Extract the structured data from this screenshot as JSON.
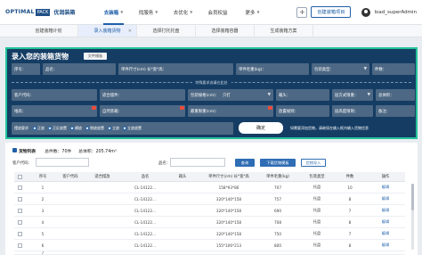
{
  "brand": {
    "logo_left": "OPTIMAL",
    "logo_box": "PACK",
    "logo_cn": "优润装箱"
  },
  "nav": [
    {
      "label": "去装箱",
      "active": true
    },
    {
      "label": "找服务"
    },
    {
      "label": "去优化"
    },
    {
      "label": "会员权益"
    },
    {
      "label": "更多"
    }
  ],
  "header": {
    "create_button": "创建装箱项目",
    "username": "load_superAdmin"
  },
  "tabs": [
    {
      "label": "创建装箱计划"
    },
    {
      "label": "录入装箱货物",
      "active": true
    },
    {
      "label": "选择打托托盘"
    },
    {
      "label": "选择装箱容器"
    },
    {
      "label": "生成装箱方案"
    }
  ],
  "entry": {
    "title": "录入您的装箱货物",
    "template_button": "文件模板",
    "fields_row1": [
      "序号：",
      "品名：",
      "单件尺寸(cm) 长*宽*高：",
      "单件毛重(kg)：",
      "包装类型：",
      "件数："
    ],
    "section_label": "特殊要求选填在此处",
    "fields_row2": [
      "客户代码：",
      "适合摆件：",
      "包装规格(cm)：",
      "箱头：",
      "层方式限重：",
      "总体积："
    ],
    "fields_row2_value": "只打",
    "fields_row3": [
      "堆高：",
      "自然装箱：",
      "最重限重(cm)：",
      "放置规则：",
      "层高度限制：",
      "备注："
    ],
    "options_label": "摆放要求",
    "options": [
      "正放",
      "正反放置",
      "横放",
      "侧放放置",
      "立放",
      "立放放置"
    ],
    "confirm_button": "确定",
    "hint": "如需要添加货物，请继续在输入框内输入货物信息"
  },
  "list": {
    "summary_title": "货物列表",
    "summary_count": "总件数：70件",
    "summary_weight": "总体积：205.74m³",
    "filter_customer_label": "客户代码：",
    "filter_name_label": "品名：",
    "search_button": "查询",
    "download_button": "下载货物模板",
    "import_button": "货物导入",
    "columns": [
      "序号",
      "客户代码",
      "适合摆放",
      "品名",
      "箱头",
      "单件尺寸(cm) 长*宽*高",
      "单件毛重(kg)",
      "包装类型",
      "件数",
      "操作"
    ],
    "rows": [
      {
        "no": "1",
        "name": "CL-14122...",
        "size": "158*93*86",
        "weight": "707",
        "pkg": "托盘",
        "qty": "10",
        "op": "编辑"
      },
      {
        "no": "2",
        "name": "CL-14122...",
        "size": "320*140*158",
        "weight": "757",
        "pkg": "托盘",
        "qty": "8",
        "op": "编辑"
      },
      {
        "no": "3",
        "name": "CL-14122...",
        "size": "320*140*158",
        "weight": "690",
        "pkg": "托盘",
        "qty": "7",
        "op": "编辑"
      },
      {
        "no": "4",
        "name": "CL-14122...",
        "size": "320*140*158",
        "weight": "708",
        "pkg": "托盘",
        "qty": "8",
        "op": "编辑"
      },
      {
        "no": "5",
        "name": "CL-14122...",
        "size": "320*140*158",
        "weight": "750",
        "pkg": "托盘",
        "qty": "7",
        "op": "编辑"
      },
      {
        "no": "6",
        "name": "CL-14122...",
        "size": "155*106*213",
        "weight": "800",
        "pkg": "托盘",
        "qty": "8",
        "op": "编辑"
      },
      {
        "no": "7",
        "name": "CL-14122...",
        "size": "320*140*158",
        "weight": "775",
        "pkg": "托盘",
        "qty": "8",
        "op": "编辑"
      }
    ]
  },
  "colors": {
    "accent": "#1e5fa8",
    "panel": "#153d64",
    "panel_border": "#22c49a"
  }
}
